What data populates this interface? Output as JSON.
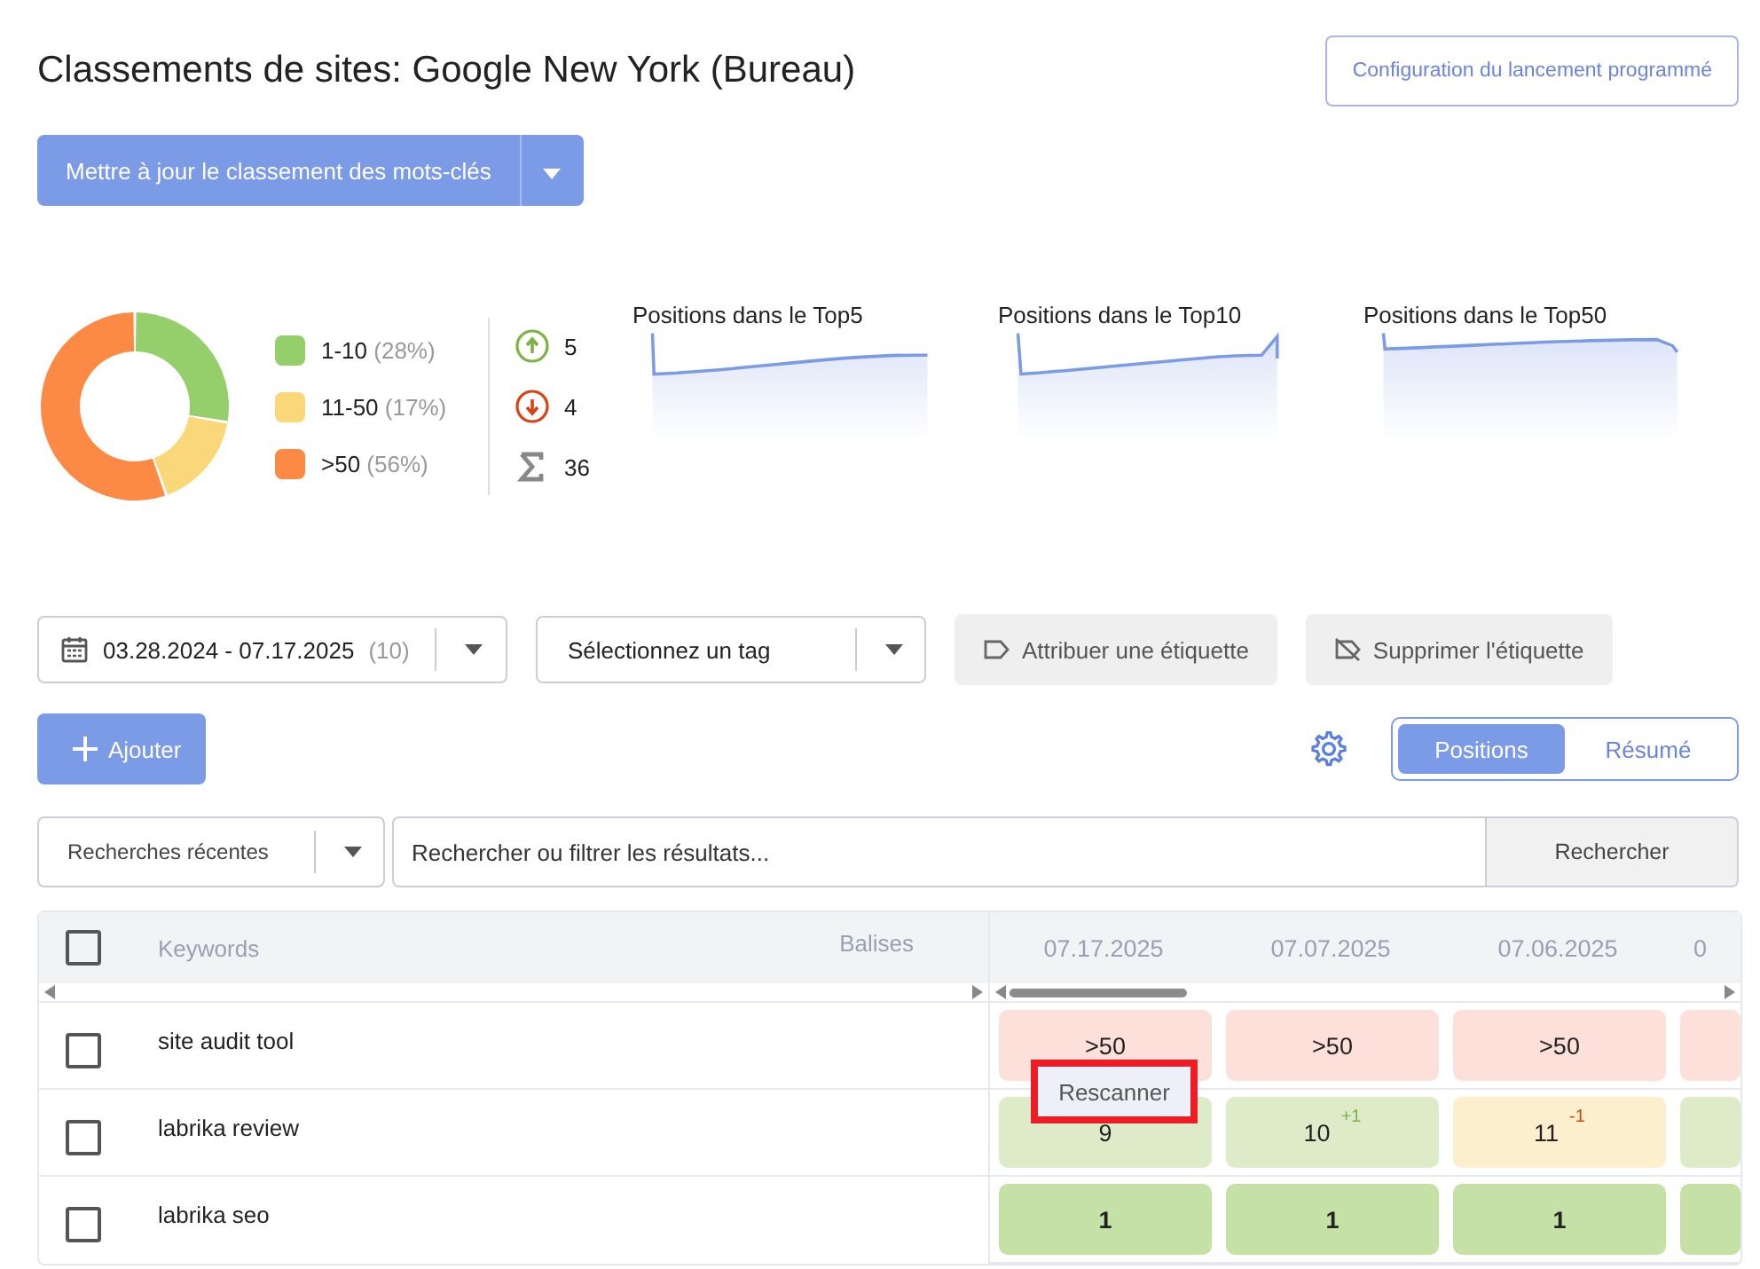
{
  "title": "Classements de sites: Google New York (Bureau)",
  "schedule_button": "Configuration du lancement programmé",
  "update_button": "Mettre à jour le classement des mots-clés",
  "distribution": {
    "chart_data": {
      "type": "donut",
      "categories": [
        "1-10",
        "11-50",
        ">50"
      ],
      "values": [
        28,
        17,
        56
      ]
    },
    "legend": [
      {
        "share": "(28%)",
        "color": "#94cf6b"
      },
      {
        "share": "(17%)",
        "color": "#fad879"
      },
      {
        "share": "(56%)",
        "color": "#fd8a44"
      }
    ]
  },
  "movement": [
    {
      "kind": "up",
      "count": "5"
    },
    {
      "kind": "down",
      "count": "4"
    },
    {
      "kind": "total",
      "count": "36"
    }
  ],
  "sparklines": [
    {
      "title": "Positions dans le Top5",
      "kind": "picture"
    },
    {
      "title": "Positions dans le Top10",
      "kind": "picture"
    },
    {
      "title": "Positions dans le Top50",
      "kind": "picture"
    }
  ],
  "date_range": {
    "value": "03.28.2024 - 07.17.2025",
    "count": "(10)"
  },
  "tag_select": {
    "placeholder": "Sélectionnez un tag"
  },
  "assign_tag_button": "Attribuer une étiquette",
  "remove_tag_button": "Supprimer l'étiquette",
  "add_button": "Ajouter",
  "view_tabs": [
    {
      "label": "Positions",
      "selected": true
    },
    {
      "label": "Résumé",
      "selected": false
    }
  ],
  "recent_searches": "Recherches récentes",
  "search": {
    "placeholder": "Rechercher ou filtrer les résultats...",
    "button": "Rechercher"
  },
  "table": {
    "select_all_checked": false,
    "columns": [
      "Keywords",
      "Balises"
    ],
    "dates": [
      "07.17.2025",
      "07.07.2025",
      "07.06.2025",
      "0"
    ],
    "rows": [
      {
        "keyword": "site audit tool",
        "checked": false,
        "cells": [
          {
            "kind": "low",
            "value": ">50"
          },
          {
            "kind": "low",
            "value": ">50"
          },
          {
            "kind": "low",
            "value": ">50"
          },
          {
            "kind": "low"
          }
        ]
      },
      {
        "keyword": "labrika review",
        "checked": false,
        "cells": [
          {
            "kind": "good",
            "value": "9"
          },
          {
            "kind": "good",
            "value": "10",
            "change": "+1",
            "color": "#7cb342"
          },
          {
            "kind": "mid",
            "value": "11",
            "change": "-1",
            "color": "#d84315"
          },
          {
            "kind": "good"
          }
        ]
      },
      {
        "keyword": "labrika seo",
        "checked": false,
        "cells": [
          {
            "kind": "top",
            "value": "1"
          },
          {
            "kind": "top",
            "value": "1"
          },
          {
            "kind": "top",
            "value": "1"
          },
          {
            "kind": "top"
          }
        ]
      }
    ]
  },
  "tooltip": "Rescanner"
}
